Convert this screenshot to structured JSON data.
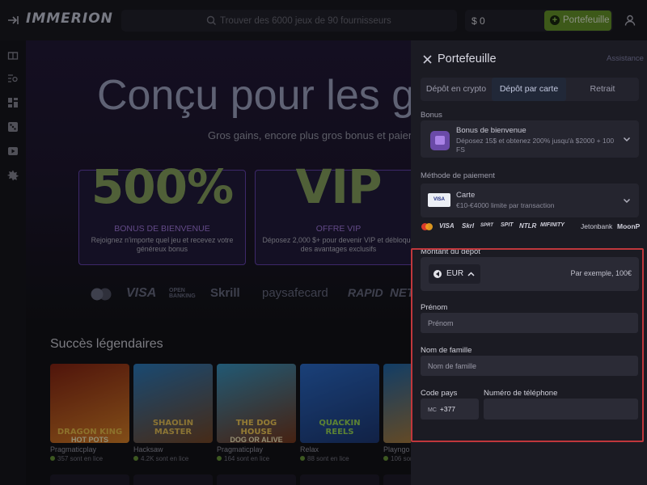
{
  "header": {
    "logo": "IMMERION",
    "search_placeholder": "Trouver des 6000 jeux de 90 fournisseurs",
    "balance": "$ 0",
    "wallet_button": "Portefeuille"
  },
  "rail": {
    "icons": [
      "gift-icon",
      "search-list-icon",
      "dashboard-icon",
      "dice-icon",
      "video-icon",
      "star-burst-icon"
    ]
  },
  "hero": {
    "title": "Conçu pour les g",
    "subtitle": "Gros gains, encore plus gros bonus et paiem",
    "cards": [
      {
        "big": "500%",
        "title": "BONUS DE BIENVENUE",
        "text": "Rejoignez n'importe quel jeu et recevez votre généreux bonus"
      },
      {
        "big": "VIP",
        "title": "OFFRE VIP",
        "text": "Déposez 2,000 $+ pour devenir VIP et débloque des avantages exclusifs"
      }
    ],
    "payment_logos": [
      "VISA",
      "OPEN BANKING",
      "Skrill",
      "paysafecard",
      "RAPID",
      "NETE"
    ]
  },
  "games_section": {
    "title": "Succès légendaires",
    "games": [
      {
        "name": "DRAGON KING",
        "sub": "HOT POTS",
        "provider": "Pragmaticplay",
        "playing": "357 sont en lice",
        "color_a": "#8a2414",
        "color_b": "#e0862a",
        "text_color": "#f2c34a"
      },
      {
        "name": "SHAOLIN MASTER",
        "sub": "",
        "provider": "Hacksaw",
        "playing": "4.2K sont en lice",
        "color_a": "#2c7fc4",
        "color_b": "#7a4a28",
        "text_color": "#f0c85a"
      },
      {
        "name": "THE DOG HOUSE",
        "sub": "DOG OR ALIVE",
        "provider": "Pragmaticplay",
        "playing": "164 sont en lice",
        "color_a": "#3a9ac8",
        "color_b": "#7a3a1e",
        "text_color": "#ffd45a"
      },
      {
        "name": "QUACKIN REELS",
        "sub": "",
        "provider": "Relax",
        "playing": "88 sont en lice",
        "color_a": "#2d6fd0",
        "color_b": "#1e3a78",
        "text_color": "#9fe05a"
      },
      {
        "name": "HE",
        "sub": "",
        "provider": "Playngo",
        "playing": "106 sont",
        "color_a": "#1f6ab0",
        "color_b": "#c9842a",
        "text_color": "#ffd24a"
      }
    ]
  },
  "panel": {
    "title": "Portefeuille",
    "assist": "Assistance",
    "tabs": [
      "Dépôt en crypto",
      "Dépôt par carte",
      "Retrait"
    ],
    "active_tab": 1,
    "bonus_label": "Bonus",
    "bonus_title": "Bonus de bienvenue",
    "bonus_desc": "Déposez 15$ et obtenez 200% jusqu'à $2000 + 100 FS",
    "method_label": "Méthode de paiement",
    "method_title": "Carte",
    "method_desc": "€10-€4000 limite par transaction",
    "card_icon": "VISA",
    "method_logos": [
      "VISA",
      "Skrl",
      "SPRT",
      "SPIT",
      "NTLR",
      "MIFINITY",
      "Jetonbank",
      "MoonP"
    ],
    "amount_label": "Montant du dépôt",
    "currency": "EUR",
    "amount_placeholder": "Par exemple, 100€",
    "first_name_label": "Prénom",
    "first_name_placeholder": "Prénom",
    "last_name_label": "Nom de famille",
    "last_name_placeholder": "Nom de famille",
    "country_code_label": "Code pays",
    "country_code": "MC",
    "dial_code": "+377",
    "phone_label": "Numéro de téléphone",
    "phone_value": ""
  },
  "colors": {
    "accent": "#6a9a2c",
    "highlight": "#c0373c",
    "purple": "#6a46b6"
  }
}
